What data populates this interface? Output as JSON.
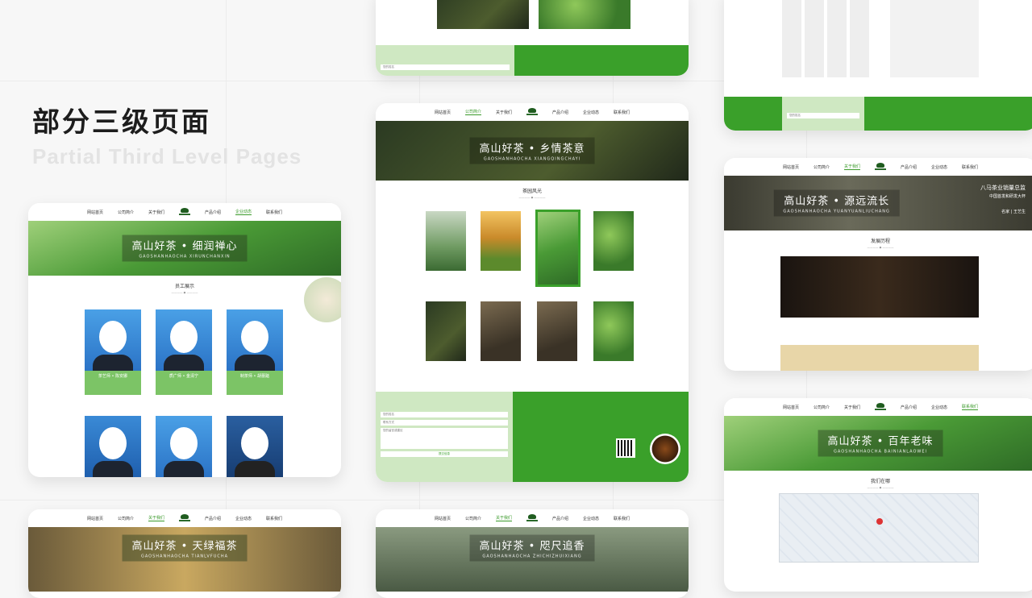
{
  "title": {
    "cn": "部分三级页面",
    "en": "Partial Third Level Pages"
  },
  "nav_items": [
    "网站首页",
    "公司简介",
    "关于我们",
    "产品介绍",
    "企业动态",
    "联系我们"
  ],
  "cards": {
    "team": {
      "banner_cn": "高山好茶 • 细润禅心",
      "banner_en": "GAOSHANHAOCHA XIRUNCHANXIN",
      "section_title": "员工展示",
      "staff": [
        {
          "name": "茶艺师 • 陈安娜"
        },
        {
          "name": "质广师 • 金清宁"
        },
        {
          "name": "制茶师 • 胡蕾踮"
        }
      ]
    },
    "gallery": {
      "banner_cn": "高山好茶 • 乡情茶意",
      "banner_en": "GAOSHANHAOCHA XIANGQINGCHAYI",
      "section_title": "茶园风光"
    },
    "story": {
      "banner_cn": "高山好茶 • 源远流长",
      "banner_en": "GAOSHANHAOCHA YUANYUANLIUCHANG",
      "side_title": "八马茶业销量总监",
      "side_line": "中国首发和研发大杯",
      "side_name": "名家 | 王艺生",
      "section_title": "发展历程"
    },
    "map": {
      "banner_cn": "高山好茶 • 百年老味",
      "banner_en": "GAOSHANHAOCHA BAINIANLAOWEI",
      "section_title": "我们在哪"
    },
    "bottom_left": {
      "banner_cn": "高山好茶 • 天绿福茶",
      "banner_en": "GAOSHANHAOCHA TIANLVFUCHA"
    },
    "bottom_mid": {
      "banner_cn": "高山好茶 • 咫尺追香",
      "banner_en": "GAOSHANHAOCHA ZHICHIZHUIXIANG"
    }
  },
  "footer": {
    "inputs": [
      "您的姓名",
      "联系方式",
      "您的留言或建议"
    ],
    "submit": "提交信息"
  },
  "colors": {
    "brand_green": "#3aa02a",
    "light_green": "#cfe8c2"
  }
}
